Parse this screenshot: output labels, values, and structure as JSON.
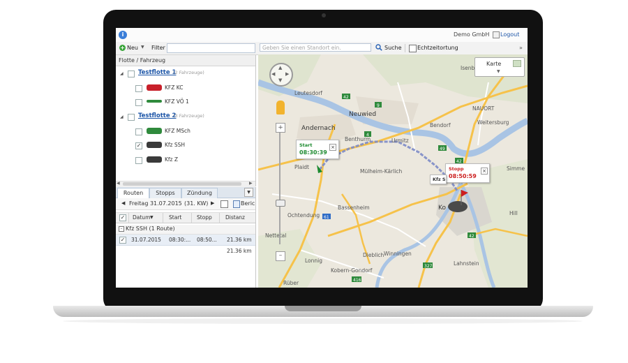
{
  "app": {
    "company": "Demo GmbH",
    "logout": "Logout"
  },
  "toolbar": {
    "new_label": "Neu",
    "filter_label": "Filter",
    "filter_value": "",
    "location_placeholder": "Geben Sie einen Standort ein.",
    "search_label": "Suche",
    "realtime_label": "Echtzeitortung"
  },
  "tree": {
    "header": "Flotte / Fahrzeug",
    "groups": [
      {
        "name": "Testflotte 1",
        "count": "(2 Fahrzeuge)",
        "vehicles": [
          {
            "name": "KFZ KC",
            "checked": false,
            "color": "#c8202a"
          },
          {
            "name": "KFZ VÖ 1",
            "checked": false,
            "color": "#2f8a3c"
          }
        ]
      },
      {
        "name": "Testflotte 2",
        "count": "(3 Fahrzeuge)",
        "vehicles": [
          {
            "name": "KFZ MSch",
            "checked": false,
            "color": "#2f8a3c"
          },
          {
            "name": "Kfz SSH",
            "checked": true,
            "color": "#3a3a3a"
          },
          {
            "name": "Kfz Z",
            "checked": false,
            "color": "#3a3a3a"
          }
        ]
      }
    ]
  },
  "routes_panel": {
    "tabs": [
      "Routen",
      "Stopps",
      "Zündung"
    ],
    "active_tab": "Routen",
    "date": "Freitag 31.07.2015",
    "week": "(31. KW)",
    "report": "Beric",
    "columns": [
      "Datum",
      "Start",
      "Stopp",
      "Distanz"
    ],
    "group_label": "Kfz SSH (1 Route)",
    "rows": [
      {
        "date": "31.07.2015",
        "start": "08:30:...",
        "stop": "08:50...",
        "distance": "21.36 km"
      }
    ],
    "total": "21.36 km"
  },
  "map": {
    "type_label": "Karte",
    "labels": {
      "leutesdorf": "Leutesdorf",
      "neuwied": "Neuwied",
      "andernach": "Andernach",
      "bendorf": "Bendorf",
      "isenburg": "Isenburg",
      "nauort": "NAUORT",
      "weitersburg": "Weitersburg",
      "urmitz": "Urmitz",
      "benthurm": "Benthurm",
      "plaidt": "Plaidt",
      "mulheim": "Mülheim-Kärlich",
      "bassenheim": "Bassenheim",
      "ochtendung": "Ochtendung",
      "nettetal": "Nettetal",
      "lonnig": "Lonnig",
      "dieblich": "Dieblich",
      "winningen": "Winningen",
      "kobern": "Kobern-Gondorf",
      "lahnstein": "Lahnstein",
      "ruber": "Rüber",
      "ko": "Ko",
      "simme": "Simme",
      "hill": "Hill"
    },
    "route_shields": [
      "9",
      "61",
      "42",
      "42",
      "327",
      "416",
      "49",
      "4",
      "42"
    ],
    "start_popup": {
      "title": "Start",
      "time": "08:30:39"
    },
    "stop_popup": {
      "title": "Stopp",
      "time": "08:50:59",
      "vehicle": "Kfz S"
    }
  },
  "colors": {
    "accent": "#1d56a8",
    "route": "#7d8bc7",
    "start_green": "#1c8a2f",
    "stop_red": "#cc1f1f",
    "map_bg": "#ede8dd",
    "river": "#a9c4e4",
    "road_major": "#f6c24a"
  }
}
